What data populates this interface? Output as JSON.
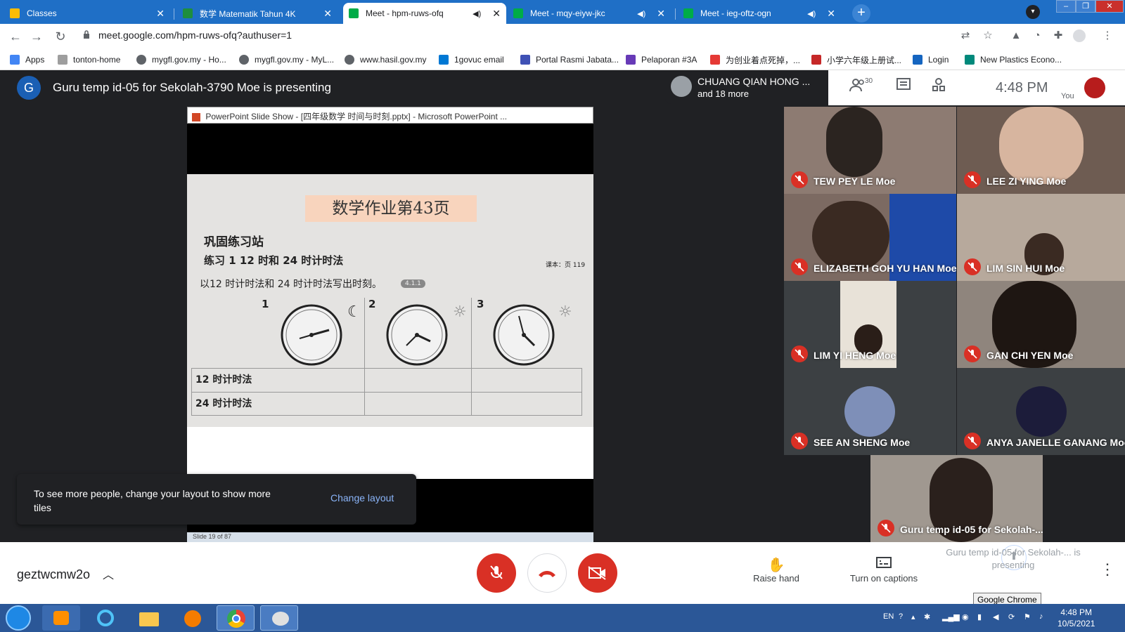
{
  "browser": {
    "tabs": [
      {
        "title": "Classes",
        "color": "#fbbc04"
      },
      {
        "title": "数学 Matematik Tahun 4K",
        "color": "#1e8e3e"
      },
      {
        "title": "Meet - hpm-ruws-ofq",
        "color": "#00ac47"
      },
      {
        "title": "Meet - mqy-eiyw-jkc",
        "color": "#00ac47"
      },
      {
        "title": "Meet - ieg-oftz-ogn",
        "color": "#00ac47"
      }
    ],
    "new_tab": "+",
    "url": "meet.google.com/hpm-ruws-ofq?authuser=1",
    "bookmarks": [
      {
        "label": "Apps",
        "color": "#4285f4"
      },
      {
        "label": "tonton-home",
        "color": "#9e9e9e"
      },
      {
        "label": "mygfl.gov.my - Ho...",
        "color": "#5f6368"
      },
      {
        "label": "mygfl.gov.my - MyL...",
        "color": "#5f6368"
      },
      {
        "label": "www.hasil.gov.my",
        "color": "#5f6368"
      },
      {
        "label": "1govuc email",
        "color": "#0078d4"
      },
      {
        "label": "Portal Rasmi Jabata...",
        "color": "#3f51b5"
      },
      {
        "label": "Pelaporan #3A",
        "color": "#673ab7"
      },
      {
        "label": "为创业着点死掉，...",
        "color": "#e53935"
      },
      {
        "label": "小学六年级上册试...",
        "color": "#c62828"
      },
      {
        "label": "Login",
        "color": "#1565c0"
      },
      {
        "label": "New Plastics Econo...",
        "color": "#00897b"
      }
    ]
  },
  "meet": {
    "avatar_letter": "G",
    "presenting_title": "Guru temp id-05 for Sekolah-3790 Moe is presenting",
    "chuang_name": "CHUANG QIAN HONG ...",
    "chuang_more": "and 18 more",
    "participants_count": "30",
    "time": "4:48  PM",
    "you_label": "You",
    "meeting_code": "geztwcmw2o",
    "raise_hand": "Raise hand",
    "captions": "Turn on captions",
    "presenting_status": "Guru temp id-05 for Sekolah-... is presenting",
    "tooltip": "Google Chrome"
  },
  "toast": {
    "message": "To see more people, change your layout to show more tiles",
    "action": "Change layout"
  },
  "slide": {
    "window_title": "PowerPoint Slide Show - [四年级数学 时间与时刻.pptx] - Microsoft PowerPoint ...",
    "homework_title": "数学作业第43页",
    "section": "巩固练习站",
    "exercise": "练习 1    12 时和 24 时计时法",
    "book_ref": "课本：页 119",
    "instruction": "以12 时计时法和 24 时计时法写出时刻。",
    "tag": "4.1.1",
    "row_12": "12 时计时法",
    "row_24": "24 时计时法",
    "clock_numbers": [
      "1",
      "2",
      "3"
    ],
    "status": "Slide 19 of 87"
  },
  "tiles": [
    {
      "name": "TEW PEY LE Moe",
      "color": "#8d7b72"
    },
    {
      "name": "LEE ZI YING Moe",
      "color": "#6e5c52"
    },
    {
      "name": "ELIZABETH GOH YU HAN Moe",
      "color": "#7c6a62"
    },
    {
      "name": "LIM SIN HUI Moe",
      "color": "#b7a99c"
    },
    {
      "name": "LIM YI HENG Moe",
      "color": "#3c4043"
    },
    {
      "name": "GAN CHI YEN Moe",
      "color": "#8f857d"
    },
    {
      "name": "SEE AN SHENG Moe",
      "color": "#3c4043"
    },
    {
      "name": "ANYA JANELLE GANANG Moe",
      "color": "#3c4043"
    },
    {
      "name": "Guru temp id-05 for Sekolah-...",
      "color": "#a09890"
    }
  ],
  "taskbar": {
    "lang": "EN",
    "time": "4:48 PM",
    "date": "10/5/2021"
  }
}
